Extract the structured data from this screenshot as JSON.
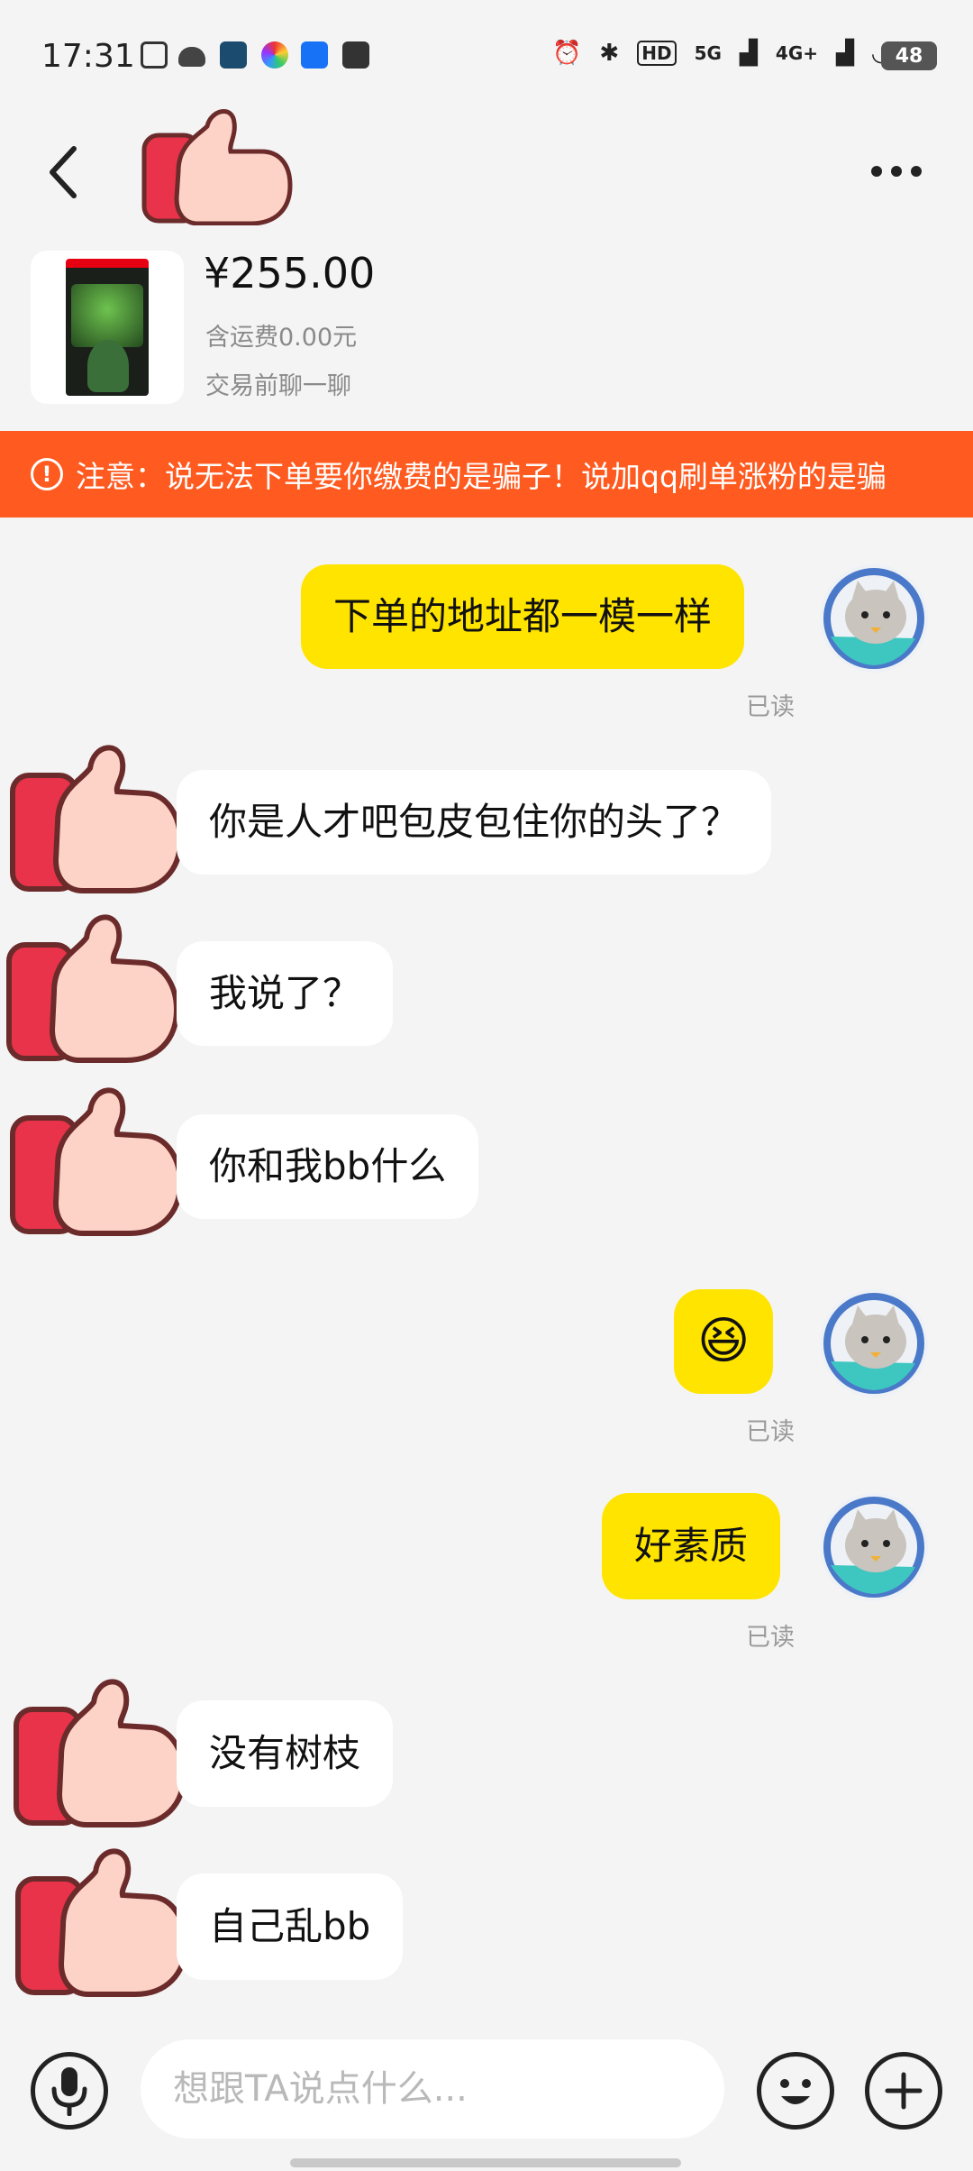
{
  "status_bar": {
    "time": "17:31",
    "indicators": [
      "HD",
      "5G",
      "4G+"
    ],
    "battery": "48"
  },
  "header": {
    "title": "",
    "back_icon": "chevron-left-icon",
    "more_icon": "more-horizontal-icon"
  },
  "product": {
    "price": "¥255.00",
    "shipping": "含运费0.00元",
    "note": "交易前聊一聊",
    "image_title": "Luigi's Mansion 3"
  },
  "warning": {
    "text": "注意：说无法下单要你缴费的是骗子！说加qq刷单涨粉的是骗"
  },
  "messages": [
    {
      "side": "mine",
      "text": "下单的地址都一模一样",
      "read": "已读"
    },
    {
      "side": "theirs",
      "text": "你是人才吧包皮包住你的头了？"
    },
    {
      "side": "theirs",
      "text": "我说了？"
    },
    {
      "side": "theirs",
      "text": "你和我bb什么"
    },
    {
      "side": "mine",
      "text": "😆",
      "read": "已读"
    },
    {
      "side": "mine",
      "text": "好素质",
      "read": "已读"
    },
    {
      "side": "theirs",
      "text": "没有树枝"
    },
    {
      "side": "theirs",
      "text": "自己乱bb"
    }
  ],
  "input": {
    "placeholder": "想跟TA说点什么..."
  },
  "colors": {
    "accent_yellow": "#ffe400",
    "warning_orange": "#ff5a1f",
    "background": "#f4f4f4"
  }
}
